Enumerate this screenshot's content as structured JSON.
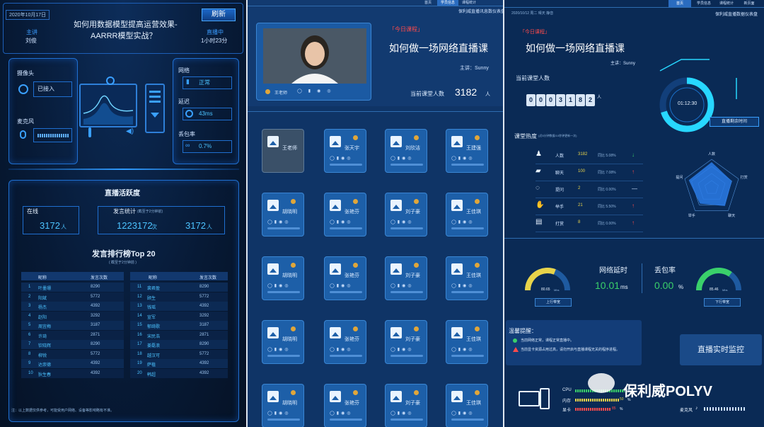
{
  "panel1": {
    "date": "2020年10月17日",
    "title_line1": "如何用数据模型提高运营效果-",
    "title_line2": "AARRR模型实战？",
    "refresh": "刷新",
    "host_label": "主讲",
    "host_name": "刘俊",
    "live_label": "直播中",
    "live_duration": "1小时23分",
    "camera_label": "摄像头",
    "camera_status": "已接入",
    "mic_label": "麦克风",
    "network_label": "网络",
    "network_status": "正常",
    "latency_label": "延迟",
    "latency_value": "43ms",
    "packet_loss_label": "丢包率",
    "packet_loss_value": "0.7%",
    "activity_title": "直播活跃度",
    "online_label": "在线",
    "online_value": "3172",
    "online_unit": "人",
    "speech_stats_label": "发言统计",
    "speech_stats_note": "(截至于2分钟前)",
    "speech_count": "1223172",
    "speech_count_unit": "次",
    "speech_people": "3172",
    "speech_people_unit": "人",
    "rank_title": "发言排行榜Top 20",
    "rank_note": "( 截至于2分钟前 )",
    "col_nick": "昵称",
    "col_count": "发言次数",
    "ranking_left": [
      {
        "no": "1",
        "name": "叶墨珊",
        "count": "8290"
      },
      {
        "no": "2",
        "name": "阳斌",
        "count": "5772"
      },
      {
        "no": "3",
        "name": "杨杰",
        "count": "4392"
      },
      {
        "no": "4",
        "name": "赵阳",
        "count": "3292"
      },
      {
        "no": "5",
        "name": "周宜梅",
        "count": "3187"
      },
      {
        "no": "6",
        "name": "许琦",
        "count": "2871"
      },
      {
        "no": "7",
        "name": "钦晓辉",
        "count": "8290"
      },
      {
        "no": "8",
        "name": "柳锐",
        "count": "5772"
      },
      {
        "no": "9",
        "name": "达崇德",
        "count": "4392"
      },
      {
        "no": "10",
        "name": "狄生春",
        "count": "4392"
      }
    ],
    "ranking_right": [
      {
        "no": "11",
        "name": "裴君盈",
        "count": "8290"
      },
      {
        "no": "12",
        "name": "顾生",
        "count": "5772"
      },
      {
        "no": "13",
        "name": "钱瑶",
        "count": "4392"
      },
      {
        "no": "14",
        "name": "宣军",
        "count": "3292"
      },
      {
        "no": "15",
        "name": "郁绮歌",
        "count": "3187"
      },
      {
        "no": "16",
        "name": "宋民浩",
        "count": "2871"
      },
      {
        "no": "17",
        "name": "姜磊浪",
        "count": "8290"
      },
      {
        "no": "18",
        "name": "越汉可",
        "count": "5772"
      },
      {
        "no": "19",
        "name": "萨植",
        "count": "4392"
      },
      {
        "no": "20",
        "name": "韩超",
        "count": "4392"
      }
    ],
    "footnote": "注：以上数据仅供参考，可能受用户网络、设备等影响略有不准。"
  },
  "panel2": {
    "tabs": [
      "首页",
      "学员信息",
      "课程统计"
    ],
    "header_brand": "保利威直播讯息数仪表盘",
    "today_tag": "「今日课程」",
    "course_title": "如何做一场网络直播课",
    "host": "主讲：Sunny",
    "current_label": "当前课堂人数",
    "current_value": "3182",
    "current_unit": "人",
    "host_tile_label": "王老师",
    "students": [
      "张天宇",
      "刘欣洁",
      "王建强",
      "胡晓明",
      "张艳芬",
      "刘子豪",
      "王佳琪",
      "胡晓明",
      "张艳芬",
      "刘子豪",
      "王佳琪",
      "胡晓明",
      "张艳芬",
      "刘子豪",
      "王佳琪",
      "胡晓明",
      "张艳芬",
      "刘子豪",
      "王佳琪"
    ]
  },
  "panel3": {
    "tabs": [
      "首页",
      "学员信息",
      "课程统计",
      "新页面"
    ],
    "date_line": "2020/10/12  周二  晴天  静音",
    "header_brand": "保利威直播数据仪表盘",
    "today_tag": "「今日课程」",
    "course_title": "如何做一场网络直播课",
    "host": "主讲：Sunny",
    "current_label": "当前课堂人数",
    "digits": [
      "0",
      "0",
      "0",
      "3",
      "1",
      "8",
      "2"
    ],
    "digit_unit": "人",
    "timer": "01:12:30",
    "remaining_btn": "直播剩余时间",
    "heat_title": "课堂热度",
    "heat_note": "(近5分钟数据/10秒钟更新一次)",
    "heat_rows": [
      {
        "icon": "person-icon",
        "label": "人数",
        "value": "3182",
        "ratio": "同比 5.08%",
        "trend": "↓",
        "trend_color": "#3ad06a"
      },
      {
        "icon": "chat-icon",
        "label": "聊天",
        "value": "100",
        "ratio": "同比 7.08%",
        "trend": "↑",
        "trend_color": "#ff4b4b"
      },
      {
        "icon": "question-icon",
        "label": "提问",
        "value": "2",
        "ratio": "同比 0.00%",
        "trend": "—",
        "trend_color": "#cfe3ff"
      },
      {
        "icon": "hand-icon",
        "label": "举手",
        "value": "21",
        "ratio": "同比 5.50%",
        "trend": "↑",
        "trend_color": "#ff4b4b"
      },
      {
        "icon": "gift-icon",
        "label": "打赏",
        "value": "8",
        "ratio": "同比 0.00%",
        "trend": "↑",
        "trend_color": "#ff4b4b"
      }
    ],
    "radar_labels": [
      "人数",
      "打赏",
      "聊天",
      "举手",
      "提问"
    ],
    "radar_values": [
      0.9,
      0.75,
      0.8,
      0.7,
      0.85
    ],
    "up_speed": "80.65",
    "up_speed_unit": "Mbs",
    "up_label": "上行带宽",
    "up_fraction": 0.62,
    "down_speed": "85.46",
    "down_speed_unit": "Mbs",
    "down_label": "下行带宽",
    "down_fraction": 0.7,
    "latency_title": "网络延时",
    "latency_value": "10.01",
    "latency_unit": "ms",
    "loss_title": "丢包率",
    "loss_value": "0.00",
    "loss_unit": "%",
    "tips_title": "温馨提醒：",
    "tip1": "当前网络正常，课程正常直播中。",
    "tip2": "当前显卡资源占用过高，请勿开启与直播课程无关的程序进程。",
    "monitor_btn": "直播实时监控",
    "cpu_label": "CPU",
    "cpu_pct": "%",
    "mem_label": "内存",
    "mem_value": "50",
    "mem_pct": "%",
    "gpu_label": "显卡",
    "gpu_value": "85",
    "gpu_pct": "%",
    "mic_label": "麦克风",
    "watermark": "保利威POLYV"
  }
}
